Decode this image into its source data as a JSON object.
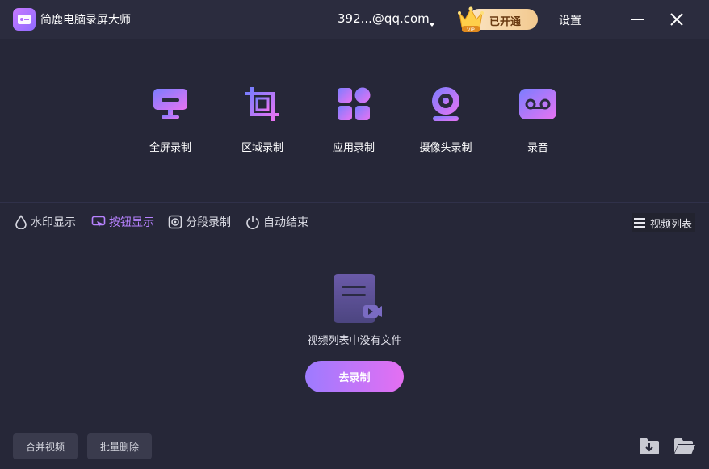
{
  "titlebar": {
    "app_title": "简鹿电脑录屏大师",
    "account": "392...@qq.com",
    "vip_label": "已开通",
    "vip_badge": "VIP",
    "settings_label": "设置"
  },
  "modes": [
    {
      "label": "全屏录制",
      "icon": "monitor-icon"
    },
    {
      "label": "区域录制",
      "icon": "crop-icon"
    },
    {
      "label": "应用录制",
      "icon": "apps-grid-icon"
    },
    {
      "label": "摄像头录制",
      "icon": "webcam-icon"
    },
    {
      "label": "录音",
      "icon": "voicemail-icon"
    }
  ],
  "toolbar": {
    "watermark": "水印显示",
    "button_display": "按钮显示",
    "segment": "分段录制",
    "auto_end": "自动结束",
    "video_list": "视频列表"
  },
  "empty": {
    "message": "视频列表中没有文件",
    "record_button": "去录制"
  },
  "bottom": {
    "merge": "合并视频",
    "batch_delete": "批量删除"
  },
  "colors": {
    "background": "#262738",
    "accent_purple": "#b782ff",
    "gradient_start": "#9d7bff",
    "gradient_end": "#e46ff2"
  }
}
